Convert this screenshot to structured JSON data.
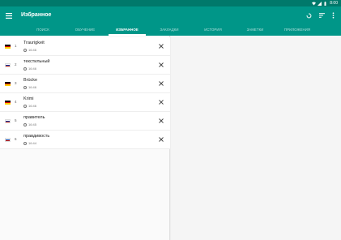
{
  "statusbar": {
    "time": "8:00"
  },
  "appbar": {
    "title": "Избранное"
  },
  "tabs": [
    {
      "label": "ПОИСК",
      "active": false
    },
    {
      "label": "ОБУЧЕНИЕ",
      "active": false
    },
    {
      "label": "ИЗБРАННОЕ",
      "active": true
    },
    {
      "label": "ЗАКЛАДКИ",
      "active": false
    },
    {
      "label": "ИСТОРИЯ",
      "active": false
    },
    {
      "label": "ЗАМЕТКИ",
      "active": false
    },
    {
      "label": "ПРИЛОЖЕНИЯ",
      "active": false
    }
  ],
  "favorites": [
    {
      "number": "1",
      "word": "Traurigkeit",
      "time": "16:46",
      "flag": "de"
    },
    {
      "number": "2",
      "word": "текстильный",
      "time": "16:46",
      "flag": "ru"
    },
    {
      "number": "3",
      "word": "Brücke",
      "time": "16:46",
      "flag": "de"
    },
    {
      "number": "4",
      "word": "Krimi",
      "time": "16:46",
      "flag": "de"
    },
    {
      "number": "5",
      "word": "правитель",
      "time": "16:45",
      "flag": "ru"
    },
    {
      "number": "6",
      "word": "правдивость",
      "time": "16:44",
      "flag": "ru"
    }
  ],
  "colors": {
    "primary": "#009688",
    "primary_dark": "#00796b",
    "flag_de": [
      "#000000",
      "#dd0000",
      "#ffce00"
    ],
    "flag_ru": [
      "#ffffff",
      "#0039a6",
      "#d52b1e"
    ]
  },
  "icons": {
    "menu": "menu-icon",
    "refresh": "refresh-icon",
    "sort": "sort-icon",
    "more": "more-vert-icon",
    "delete": "close-icon",
    "time": "clock-icon"
  }
}
